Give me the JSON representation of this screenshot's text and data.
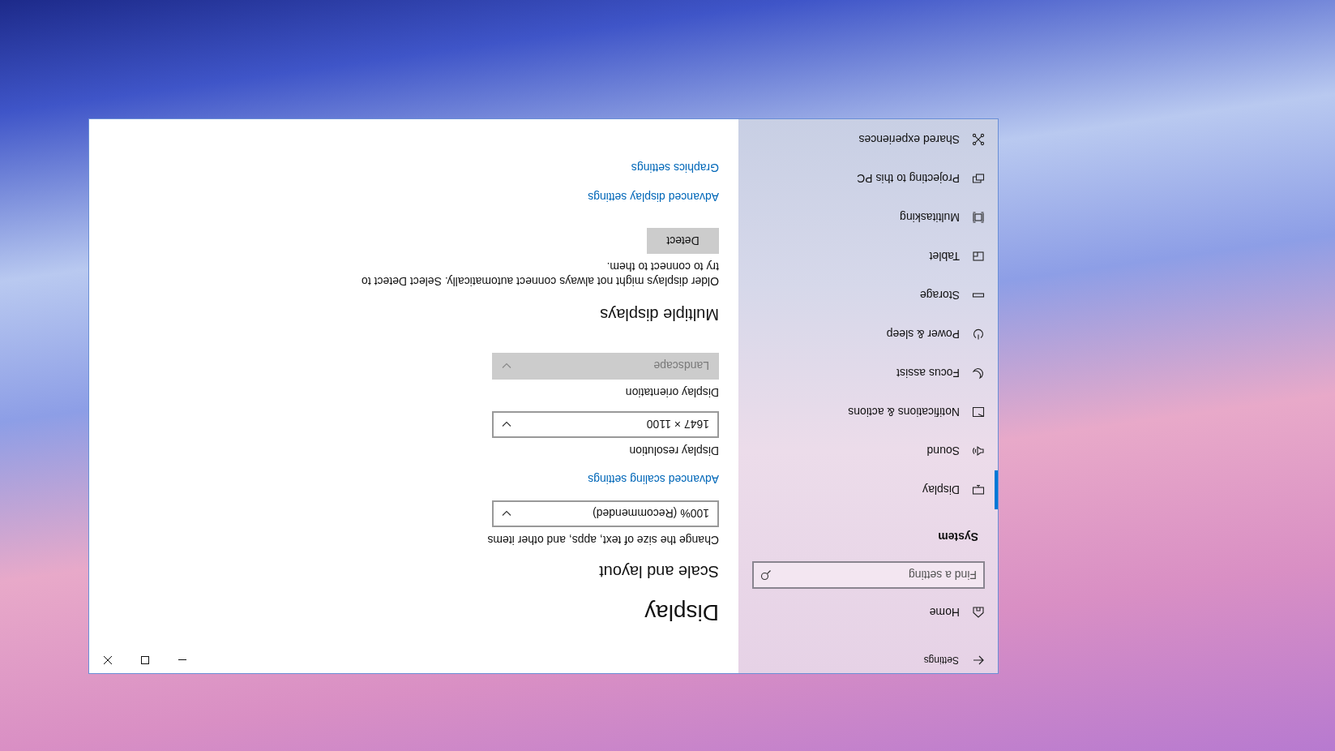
{
  "window": {
    "title": "Settings"
  },
  "sidebar": {
    "home": "Home",
    "search": {
      "placeholder": "Find a setting"
    },
    "section": "System",
    "items": [
      {
        "label": "Display",
        "selected": true
      },
      {
        "label": "Sound",
        "selected": false
      },
      {
        "label": "Notifications & actions",
        "selected": false
      },
      {
        "label": "Focus assist",
        "selected": false
      },
      {
        "label": "Power & sleep",
        "selected": false
      },
      {
        "label": "Storage",
        "selected": false
      },
      {
        "label": "Tablet",
        "selected": false
      },
      {
        "label": "Multitasking",
        "selected": false
      },
      {
        "label": "Projecting to this PC",
        "selected": false
      },
      {
        "label": "Shared experiences",
        "selected": false
      }
    ]
  },
  "content": {
    "title": "Display",
    "sections": [
      {
        "heading": "Scale and layout",
        "items": [
          {
            "kind": "label",
            "text": "Change the size of text, apps, and other items"
          },
          {
            "kind": "dropdown",
            "value": "100% (Recommended)",
            "disabled": false
          },
          {
            "kind": "link",
            "text": "Advanced scaling settings"
          },
          {
            "kind": "label",
            "text": "Display resolution"
          },
          {
            "kind": "dropdown",
            "value": "1647 × 1100",
            "disabled": false
          },
          {
            "kind": "label",
            "text": "Display orientation"
          },
          {
            "kind": "dropdown",
            "value": "Landscape",
            "disabled": true
          }
        ]
      },
      {
        "heading": "Multiple displays",
        "items": [
          {
            "kind": "paragraph",
            "text": "Older displays might not always connect automatically. Select Detect to try to connect to them."
          },
          {
            "kind": "button",
            "text": "Detect"
          },
          {
            "kind": "link",
            "text": "Advanced display settings"
          },
          {
            "kind": "link",
            "text": "Graphics settings"
          }
        ]
      }
    ]
  }
}
